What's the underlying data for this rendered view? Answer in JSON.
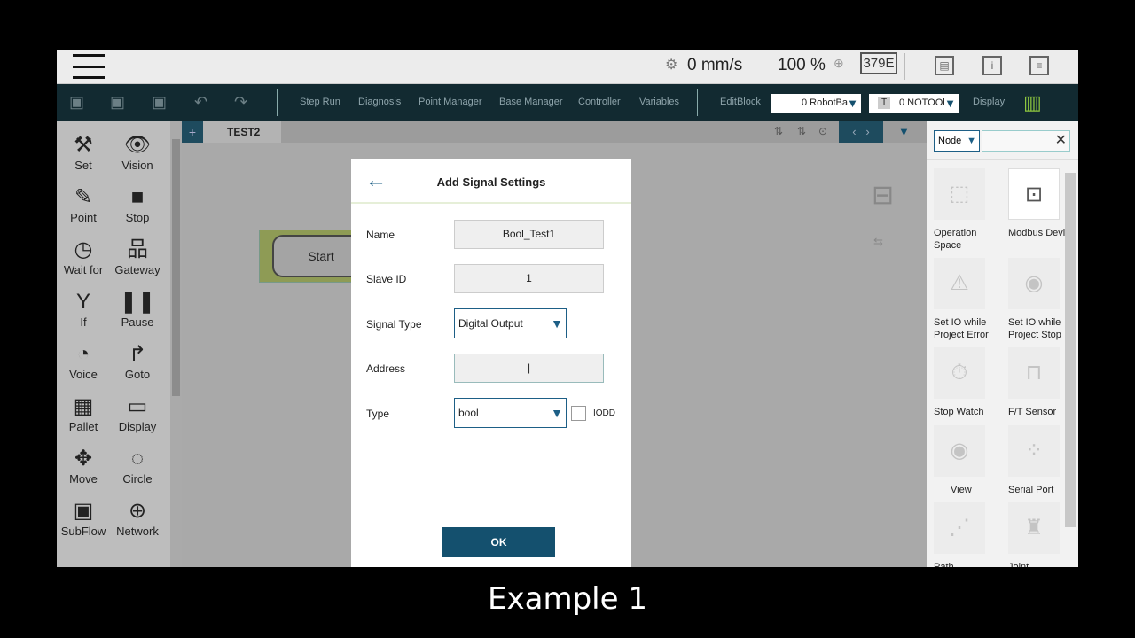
{
  "topbar": {
    "speed": "0 mm/s",
    "percent": "100 %",
    "code": "379E"
  },
  "toolbar": {
    "items": [
      "Step Run",
      "Diagnosis",
      "Point Manager",
      "Base Manager",
      "Controller",
      "Variables",
      "EditBlock"
    ],
    "base_select": "0 RobotBa",
    "tool_select": "0 NOTOOl",
    "tool_prefix": "T",
    "display": "Display"
  },
  "sidebar": {
    "tools": [
      "Set",
      "Vision",
      "Point",
      "Stop",
      "Wait for",
      "Gateway",
      "If",
      "Pause",
      "Voice",
      "Goto",
      "Pallet",
      "Display",
      "Move",
      "Circle",
      "SubFlow",
      "Network"
    ]
  },
  "tab": {
    "name": "TEST2"
  },
  "canvas": {
    "start_label": "Start"
  },
  "dialog": {
    "title": "Add Signal Settings",
    "name_label": "Name",
    "name_value": "Bool_Test1",
    "slave_label": "Slave ID",
    "slave_value": "1",
    "signal_type_label": "Signal Type",
    "signal_type_value": "Digital Output",
    "address_label": "Address",
    "address_value": "",
    "type_label": "Type",
    "type_value": "bool",
    "iodd_label": "IODD",
    "ok_label": "OK"
  },
  "right_panel": {
    "filter": "Node",
    "items": [
      "Operation Space",
      "Modbus Device",
      "Set IO while Project Error",
      "Set IO while Project Stop",
      "Stop Watch",
      "F/T Sensor",
      "View",
      "Serial Port",
      "Path",
      "Joint"
    ]
  },
  "caption": "Example 1"
}
